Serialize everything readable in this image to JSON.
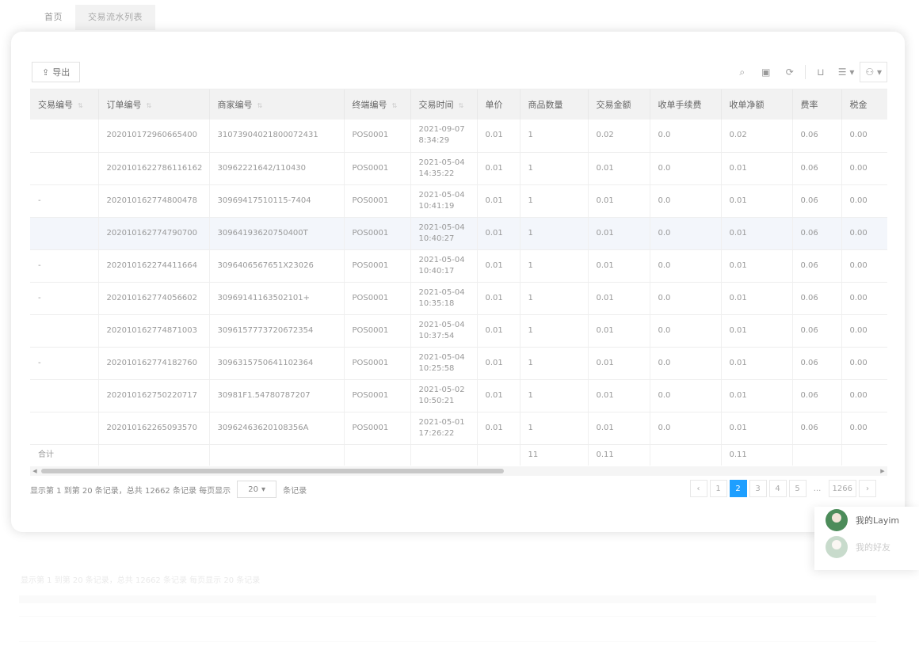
{
  "tabs": [
    {
      "label": "首页"
    },
    {
      "label": "交易流水列表",
      "active": true
    }
  ],
  "toolbar": {
    "export_label": "导出",
    "tools": [
      "search-icon",
      "filter-icon",
      "refresh-icon",
      "print-icon",
      "columns-icon",
      "user-icon"
    ]
  },
  "table": {
    "columns": [
      "交易编号",
      "订单编号",
      "商家编号",
      "终端编号",
      "交易时间",
      "单价",
      "商品数量",
      "交易金额",
      "收单手续费",
      "收单净额",
      "费率",
      "税金"
    ],
    "rows": [
      {
        "group": "",
        "order": "202010172960665400",
        "merchant": "31073904021800072431",
        "terminal": "POS0001",
        "time": "2021-09-07 8:34:29",
        "price": "0.01",
        "qty": "1",
        "amount": "0.02",
        "fee": "0.0",
        "net": "0.02",
        "rate": "0.06",
        "tax": "0.00"
      },
      {
        "group": "",
        "order": "2020101622786116162",
        "merchant": "30962221642/110430",
        "terminal": "POS0001",
        "time": "2021-05-04 14:35:22",
        "price": "0.01",
        "qty": "1",
        "amount": "0.01",
        "fee": "0.0",
        "net": "0.01",
        "rate": "0.06",
        "tax": "0.00"
      },
      {
        "group": "-",
        "order": "202010162774800478",
        "merchant": "30969417510115-7404",
        "terminal": "POS0001",
        "time": "2021-05-04 10:41:19",
        "price": "0.01",
        "qty": "1",
        "amount": "0.01",
        "fee": "0.0",
        "net": "0.01",
        "rate": "0.06",
        "tax": "0.00"
      },
      {
        "group": "",
        "order": "202010162774790700",
        "merchant": "30964193620750400T",
        "terminal": "POS0001",
        "time": "2021-05-04 10:40:27",
        "price": "0.01",
        "qty": "1",
        "amount": "0.01",
        "fee": "0.0",
        "net": "0.01",
        "rate": "0.06",
        "tax": "0.00",
        "highlight": true
      },
      {
        "group": "-",
        "order": "202010162274411664",
        "merchant": "3096406567651X23026",
        "terminal": "POS0001",
        "time": "2021-05-04 10:40:17",
        "price": "0.01",
        "qty": "1",
        "amount": "0.01",
        "fee": "0.0",
        "net": "0.01",
        "rate": "0.06",
        "tax": "0.00"
      },
      {
        "group": "-",
        "order": "202010162774056602",
        "merchant": "30969141163502101+",
        "terminal": "POS0001",
        "time": "2021-05-04 10:35:18",
        "price": "0.01",
        "qty": "1",
        "amount": "0.01",
        "fee": "0.0",
        "net": "0.01",
        "rate": "0.06",
        "tax": "0.00"
      },
      {
        "group": "",
        "order": "202010162774871003",
        "merchant": "3096157773720672354",
        "terminal": "POS0001",
        "time": "2021-05-04 10:37:54",
        "price": "0.01",
        "qty": "1",
        "amount": "0.01",
        "fee": "0.0",
        "net": "0.01",
        "rate": "0.06",
        "tax": "0.00"
      },
      {
        "group": "-",
        "order": "202010162774182760",
        "merchant": "3096315750641102364",
        "terminal": "POS0001",
        "time": "2021-05-04 10:25:58",
        "price": "0.01",
        "qty": "1",
        "amount": "0.01",
        "fee": "0.0",
        "net": "0.01",
        "rate": "0.06",
        "tax": "0.00"
      },
      {
        "group": "",
        "order": "202010162750220717",
        "merchant": "30981F1.54780787207",
        "terminal": "POS0001",
        "time": "2021-05-02 10:50:21",
        "price": "0.01",
        "qty": "1",
        "amount": "0.01",
        "fee": "0.0",
        "net": "0.01",
        "rate": "0.06",
        "tax": "0.00"
      },
      {
        "group": "",
        "order": "202010162265093570",
        "merchant": "30962463620108356A",
        "terminal": "POS0001",
        "time": "2021-05-01 17:26:22",
        "price": "0.01",
        "qty": "1",
        "amount": "0.01",
        "fee": "0.0",
        "net": "0.01",
        "rate": "0.06",
        "tax": "0.00"
      }
    ],
    "total": {
      "label": "合计",
      "qty": "11",
      "amount": "0.11",
      "net": "0.11"
    }
  },
  "pager": {
    "info_prefix": "显示第 1 到第 20 条记录，总共 12662 条记录  每页显示",
    "page_size": "20",
    "info_suffix": "条记录",
    "pages": [
      "‹",
      "1",
      "2",
      "3",
      "4",
      "5",
      "...",
      "1266",
      "›"
    ],
    "active_page": "2"
  },
  "users": [
    {
      "name": "我的Layim"
    },
    {
      "name": "我的好友"
    }
  ],
  "reflection": {
    "info": "显示第 1 到第 20 条记录，总共 12662 条记录  每页显示  20  条记录"
  }
}
